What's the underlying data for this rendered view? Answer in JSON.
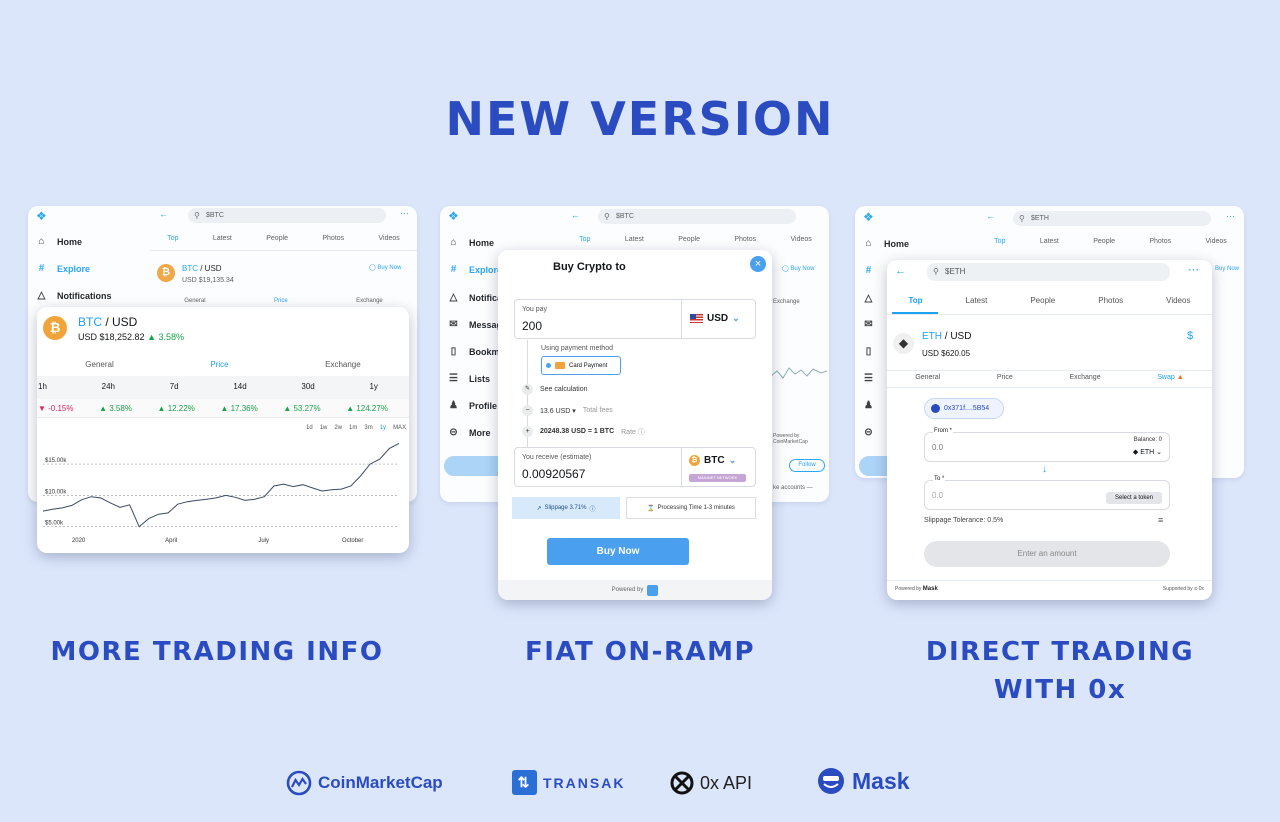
{
  "headline": "NEW VERSION",
  "captions": {
    "left": "MORE TRADING INFO",
    "center": "FIAT ON-RAMP",
    "right_line1": "DIRECT TRADING",
    "right_line2": "WITH 0x"
  },
  "twitter": {
    "sidebar": {
      "home": "Home",
      "explore": "Explore",
      "notifications": "Notifications",
      "notif_short": "Notifica",
      "messages_short": "Messag",
      "bookmarks_short": "Bookma",
      "lists": "Lists",
      "profile": "Profile",
      "more": "More"
    },
    "tabs": [
      "Top",
      "Latest",
      "People",
      "Photos",
      "Videos"
    ],
    "follow": "Follow"
  },
  "left_panel": {
    "search": "$BTC",
    "bg_pair": "BTC",
    "bg_quote": "/ USD",
    "bg_price": "USD $19,135.34",
    "buy_now": "Buy Now",
    "bg_subtabs": [
      "General",
      "Price",
      "Exchange"
    ],
    "popup": {
      "pair": "BTC",
      "quote": "/ USD",
      "price": "USD  $18,252.82",
      "change": "3.58%",
      "subtabs": [
        "General",
        "Price",
        "Exchange"
      ],
      "periods": [
        "1h",
        "24h",
        "7d",
        "14d",
        "30d",
        "1y"
      ],
      "changes": [
        {
          "v": "-0.15%",
          "dir": "down"
        },
        {
          "v": "3.58%",
          "dir": "up"
        },
        {
          "v": "12.22%",
          "dir": "up"
        },
        {
          "v": "17.36%",
          "dir": "up"
        },
        {
          "v": "53.27%",
          "dir": "up"
        },
        {
          "v": "124.27%",
          "dir": "up"
        }
      ],
      "ranges": [
        "1d",
        "1w",
        "2w",
        "1m",
        "3m",
        "1y",
        "MAX"
      ],
      "y_labels": [
        "$15.00k",
        "$10.00k",
        "$5.00k"
      ],
      "x_labels": [
        "2020",
        "April",
        "July",
        "October"
      ]
    }
  },
  "center_panel": {
    "search": "$BTC",
    "title": "Buy Crypto to",
    "you_pay_label": "You pay",
    "you_pay_value": "200",
    "currency": "USD",
    "using_payment": "Using payment method",
    "card_payment": "Card Payment",
    "see_calc": "See calculation",
    "fees": "13.6 USD",
    "total_fees": "Total fees",
    "rate_value": "20248.38 USD = 1 BTC",
    "rate": "Rate",
    "receive_label": "You receive (estimate)",
    "receive_value": "0.00920567",
    "crypto": "BTC",
    "network": "MAINNET NETWORK",
    "slippage": "Slippage 3.71%",
    "processing": "Processing Time 1-3 minutes",
    "buy_now": "Buy Now",
    "powered_by": "Powered by",
    "bg_buy_now": "Buy Now",
    "bg_exchange": "Exchange",
    "bg_powered": "Powered by CoinMarketCap",
    "bg_accounts": "ke accounts —"
  },
  "right_panel": {
    "search": "$ETH",
    "bg_buy_now": "Buy Now",
    "popup": {
      "search": "$ETH",
      "pair": "ETH",
      "quote": "/ USD",
      "price": "USD  $620.05",
      "subtabs": [
        "General",
        "Price",
        "Exchange",
        "Swap"
      ],
      "address": "0x371f....5B54",
      "from_label": "From *",
      "from_amount": "0.0",
      "balance": "Balance: 0",
      "token": "ETH",
      "to_label": "To *",
      "to_amount": "0.0",
      "select_token": "Select a token",
      "slippage": "Slippage Tolerance: 0.5%",
      "enter_amount": "Enter an amount",
      "powered_by": "Powered by",
      "mask": "Mask",
      "supported_by": "Supported by",
      "zero_x": "0x"
    }
  },
  "logos": {
    "coinmarketcap": "CoinMarketCap",
    "transak": "TRANSAK",
    "zerox_api": "0x API",
    "mask": "Mask"
  },
  "colors": {
    "brand": "#2a4cc0",
    "twitter_blue": "#1da1f2",
    "up": "#17a34a",
    "down": "#e0245e",
    "button": "#4a9fee"
  },
  "chart_data": {
    "type": "line",
    "title": "",
    "series": [
      {
        "values": [
          7.5,
          7.8,
          8.0,
          8.4,
          9.3,
          9.8,
          9.6,
          8.8,
          8.1,
          8.5,
          5.0,
          6.3,
          7.0,
          7.2,
          8.6,
          9.0,
          9.2,
          9.4,
          9.6,
          10.0,
          9.7,
          9.2,
          9.4,
          9.8,
          11.5,
          11.8,
          11.4,
          11.7,
          11.2,
          10.7,
          10.9,
          11.0,
          11.5,
          13.1,
          15.0,
          15.8,
          17.5,
          18.3
        ]
      }
    ],
    "ylim": [
      4,
      19
    ],
    "y_ticks": [
      "$15.00k",
      "$10.00k",
      "$5.00k"
    ],
    "x_ticks": [
      "2020",
      "April",
      "July",
      "October"
    ],
    "grid": true
  }
}
